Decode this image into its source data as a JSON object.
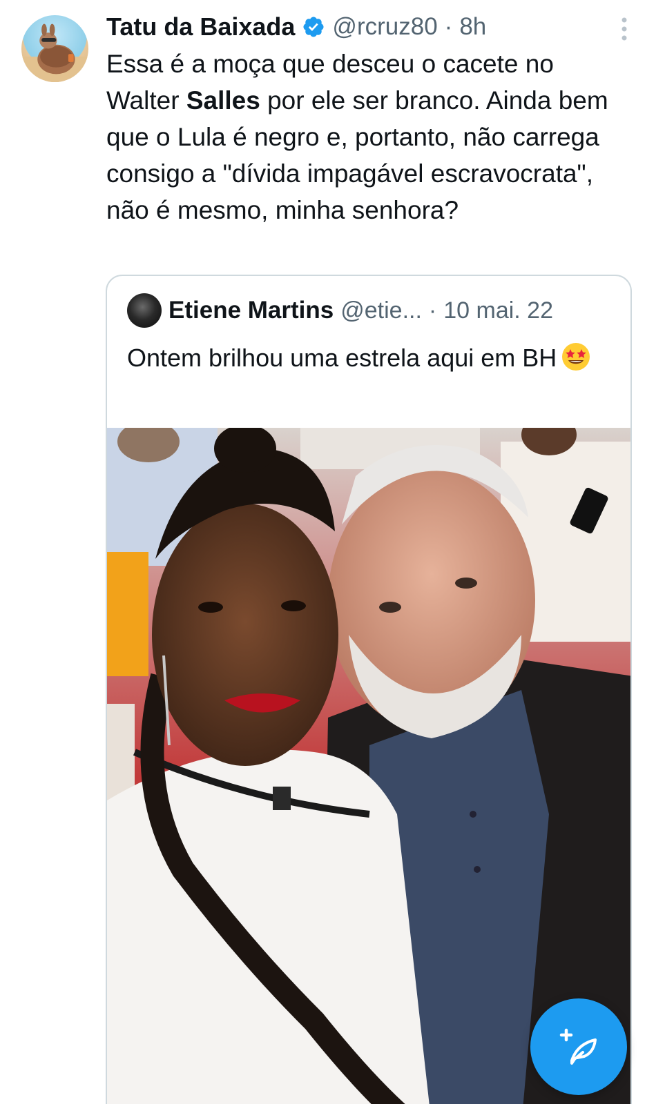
{
  "tweet": {
    "author": {
      "display_name": "Tatu da Baixada",
      "verified": true,
      "handle": "@rcruz80",
      "avatar_icon": "armadillo-avatar"
    },
    "separator": "·",
    "time": "8h",
    "text_before_bold": "Essa é a moça que desceu o cacete no Walter ",
    "text_bold": "Salles",
    "text_after_bold": " por ele ser branco. Ainda bem que o Lula é negro e, portanto, não carrega consigo a \"dívida impagável escravocrata\", não é mesmo, minha senhora?"
  },
  "quote": {
    "author": {
      "display_name": "Etiene Martins",
      "handle": "@etie...",
      "avatar_icon": "profile-avatar"
    },
    "separator": "·",
    "date": "10 mai. 22",
    "text": "Ontem brilhou uma estrela aqui em BH",
    "emoji": "star-struck-emoji",
    "photo": "selfie-photo"
  },
  "colors": {
    "accent": "#1d9bf0",
    "text_primary": "#0f1419",
    "text_secondary": "#536471",
    "border": "#cfd9de"
  },
  "fab": {
    "icon": "compose-tweet-icon"
  }
}
